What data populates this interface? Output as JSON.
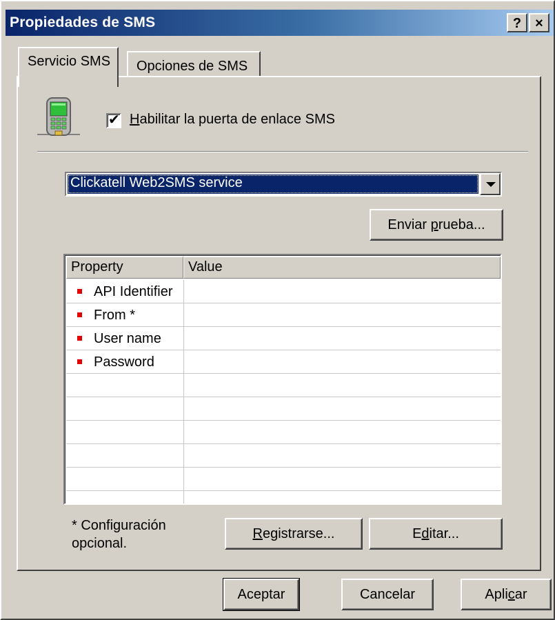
{
  "window": {
    "title": "Propiedades de SMS",
    "help_button": "?",
    "close_button": "×"
  },
  "tabs": [
    {
      "label": "Servicio SMS",
      "active": true
    },
    {
      "label": "Opciones de SMS",
      "active": false
    }
  ],
  "icons": {
    "phone": "mobile-phone-icon"
  },
  "gateway": {
    "enabled": true,
    "checkbox_label_prefix": "H",
    "checkbox_label_rest": "abilitar la puerta de enlace SMS"
  },
  "service_select": {
    "value": "Clickatell Web2SMS service"
  },
  "send_test_button": {
    "pre": "Enviar ",
    "accel": "p",
    "post": "rueba..."
  },
  "properties_table": {
    "columns": [
      "Property",
      "Value"
    ],
    "rows": [
      {
        "name": "API Identifier",
        "value": ""
      },
      {
        "name": "From *",
        "value": ""
      },
      {
        "name": "User name",
        "value": ""
      },
      {
        "name": "Password",
        "value": ""
      }
    ],
    "bullet_color": "#e00000"
  },
  "note": {
    "line1": "* Configuración",
    "line2": "opcional."
  },
  "register_button": {
    "accel": "R",
    "post": "egistrarse..."
  },
  "edit_button": {
    "pre": "E",
    "accel": "d",
    "post": "itar..."
  },
  "footer": {
    "ok": "Aceptar",
    "cancel": "Cancelar",
    "apply_pre": "Apli",
    "apply_accel": "c",
    "apply_post": "ar"
  },
  "colors": {
    "titlebar_start": "#0a246a",
    "titlebar_end": "#a6caf0",
    "face": "#d4d0c8",
    "selection": "#0a246a"
  }
}
